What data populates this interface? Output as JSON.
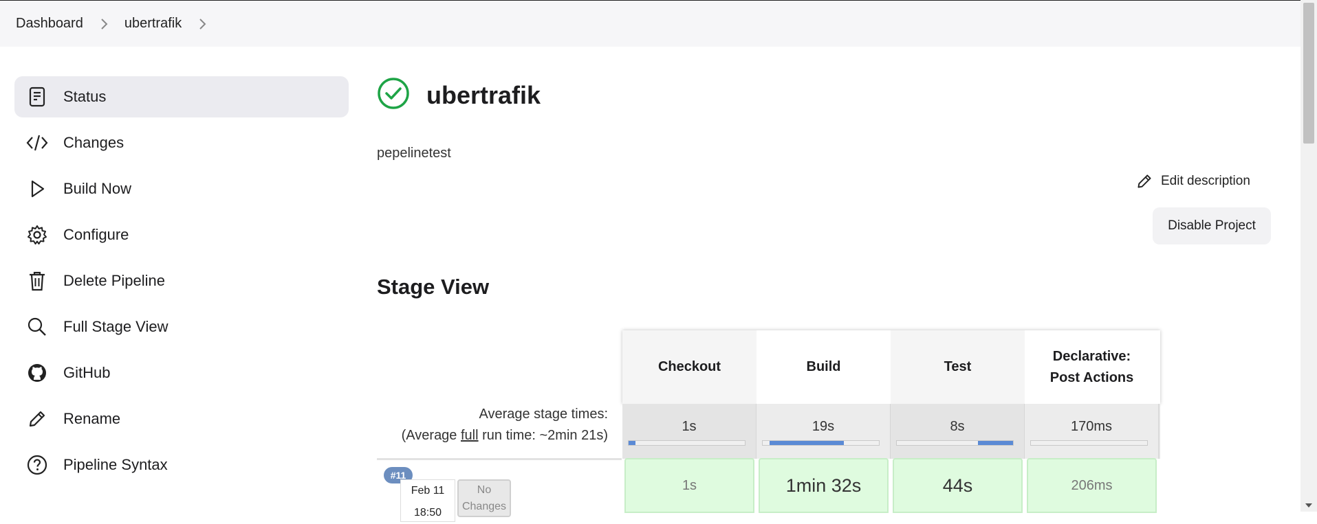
{
  "breadcrumb": {
    "items": [
      "Dashboard",
      "ubertrafik"
    ]
  },
  "sidebar": {
    "items": [
      {
        "label": "Status",
        "icon": "status-icon",
        "active": true
      },
      {
        "label": "Changes",
        "icon": "code-icon"
      },
      {
        "label": "Build Now",
        "icon": "play-icon"
      },
      {
        "label": "Configure",
        "icon": "gear-icon"
      },
      {
        "label": "Delete Pipeline",
        "icon": "trash-icon"
      },
      {
        "label": "Full Stage View",
        "icon": "search-icon"
      },
      {
        "label": "GitHub",
        "icon": "github-icon"
      },
      {
        "label": "Rename",
        "icon": "pencil-icon"
      },
      {
        "label": "Pipeline Syntax",
        "icon": "help-icon"
      }
    ]
  },
  "header": {
    "title": "ubertrafik",
    "status_color": "#1ea446",
    "description": "pepelinetest",
    "edit_description": "Edit description",
    "disable_project": "Disable Project"
  },
  "stage_view": {
    "heading": "Stage View",
    "avg_label_line1": "Average stage times:",
    "avg_label_line2_pre": "(Average ",
    "avg_label_line2_link": "full",
    "avg_label_line2_post": " run time: ~2min 21s)",
    "stages": [
      {
        "name_line1": "Checkout",
        "name_line2": "",
        "avg": "1s",
        "bar_start": 0.0,
        "bar_fraction": 0.06
      },
      {
        "name_line1": "Build",
        "name_line2": "",
        "avg": "19s",
        "bar_start": 0.06,
        "bar_fraction": 0.64
      },
      {
        "name_line1": "Test",
        "name_line2": "",
        "avg": "8s",
        "bar_start": 0.7,
        "bar_fraction": 0.3
      },
      {
        "name_line1": "Declarative:",
        "name_line2": "Post Actions",
        "avg": "170ms",
        "bar_start": 0.0,
        "bar_fraction": 0.0
      }
    ],
    "run": {
      "badge": "#11",
      "date_line1": "Feb 11",
      "date_line2": "18:50",
      "changes_line1": "No",
      "changes_line2": "Changes",
      "durations": [
        "1s",
        "1min 32s",
        "44s",
        "206ms"
      ]
    }
  }
}
